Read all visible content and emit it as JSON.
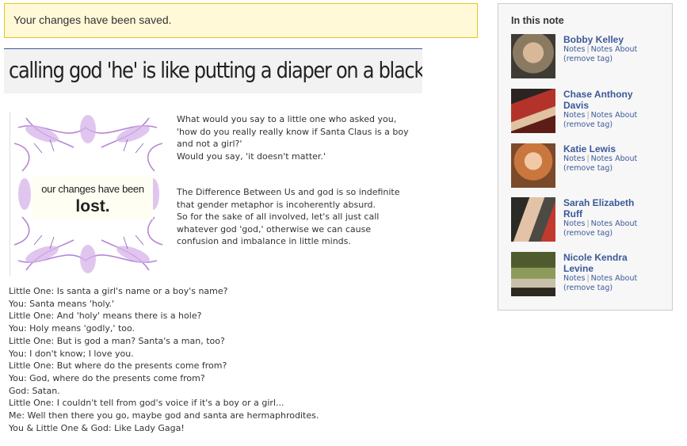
{
  "notice": {
    "text": "Your changes have been saved."
  },
  "note": {
    "title": "calling god 'he' is like putting a diaper on a blackhole",
    "image": {
      "line1": "our changes have been",
      "line2": "lost."
    },
    "paragraph1": [
      "What would you say to a little one who asked you,",
      "'how do you really really know if Santa Claus is a boy",
      "and not a girl?'",
      "Would you say, 'it doesn't matter.'"
    ],
    "paragraph2": [
      "The Difference Between Us and god is so indefinite",
      "that gender metaphor is incoherently absurd.",
      "So for the sake of all involved, let's all just call",
      "whatever god 'god,' otherwise we can cause",
      "confusion and imbalance in little minds."
    ],
    "dialog": [
      "Little One: Is santa a girl's name or a boy's name?",
      "You: Santa means 'holy.'",
      "Little One: And 'holy' means there is a hole?",
      "You: Holy means 'godly,' too.",
      "Little One: But is god a man? Santa's a man, too?",
      "You: I don't know; I love you.",
      "Little One: But where do the presents come from?",
      "You: God, where do the presents come from?",
      "God: Satan.",
      "Little One: I couldn't tell from god's voice if it's a boy or a girl...",
      "Me: Well then there you go, maybe god and santa are hermaphrodites.",
      "You & Little One & God: Like Lady Gaga!"
    ]
  },
  "sidebar": {
    "title": "In this note",
    "links": {
      "notes": "Notes",
      "separator": "|",
      "notes_about": "Notes About",
      "remove": "(remove tag)"
    },
    "people": [
      {
        "name_lines": [
          "Bobby Kelley"
        ],
        "photo_color": "#8a7a62"
      },
      {
        "name_lines": [
          "Chase Anthony",
          "Davis"
        ],
        "photo_color": "#7a2a22"
      },
      {
        "name_lines": [
          "Katie Lewis"
        ],
        "photo_color": "#c9773f"
      },
      {
        "name_lines": [
          "Sarah Elizabeth",
          "Ruff"
        ],
        "photo_color": "#4d4a44"
      },
      {
        "name_lines": [
          "Nicole Kendra",
          "Levine"
        ],
        "photo_color": "#6f7a45"
      }
    ]
  },
  "colors": {
    "link": "#3b5998",
    "notice_bg": "#fff9d7",
    "notice_border": "#e2c822"
  }
}
